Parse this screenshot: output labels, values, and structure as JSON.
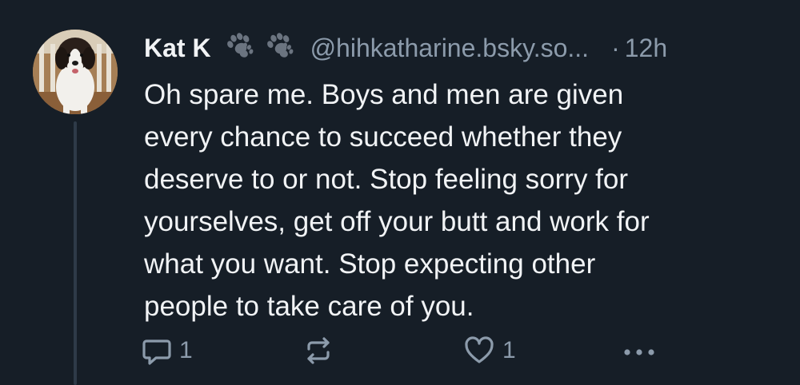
{
  "post": {
    "author": {
      "display_name": "Kat K",
      "handle": "@hihkatharine.bsky.so...",
      "avatar_icon": "dog-avatar",
      "badge_icons": [
        "paw-print-icon",
        "paw-print-icon"
      ]
    },
    "separator": "·",
    "timestamp": "12h",
    "text": "Oh spare me. Boys and men are given\nevery chance to succeed whether they\ndeserve to or not.  Stop feeling sorry for\nyourselves, get off your butt and work for\nwhat you want. Stop expecting other\npeople to take care of you.",
    "actions": {
      "reply_count": "1",
      "repost_count": "",
      "like_count": "1"
    }
  },
  "colors": {
    "background": "#161e27",
    "text_primary": "#f1f3f5",
    "text_secondary": "#8c9bab",
    "thread_line": "#2e3a48"
  }
}
